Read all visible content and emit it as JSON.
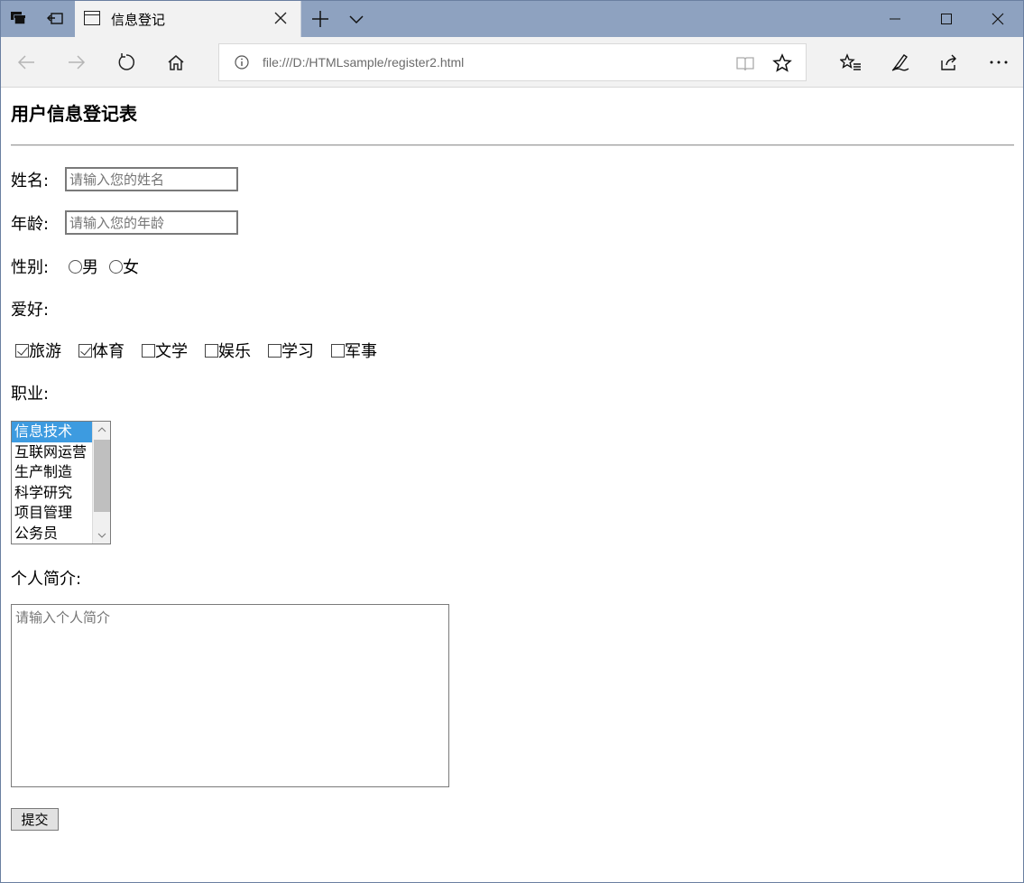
{
  "browser": {
    "tab_title": "信息登记",
    "url": "file:///D:/HTMLsample/register2.html"
  },
  "page": {
    "title": "用户信息登记表",
    "name_label": "姓名:",
    "name_placeholder": "请输入您的姓名",
    "age_label": "年龄:",
    "age_placeholder": "请输入您的年龄",
    "gender_label": "性别:",
    "gender_options": [
      "男",
      "女"
    ],
    "hobby_label": "爱好:",
    "hobbies": [
      {
        "label": "旅游",
        "checked": true
      },
      {
        "label": "体育",
        "checked": true
      },
      {
        "label": "文学",
        "checked": false
      },
      {
        "label": "娱乐",
        "checked": false
      },
      {
        "label": "学习",
        "checked": false
      },
      {
        "label": "军事",
        "checked": false
      }
    ],
    "job_label": "职业:",
    "jobs": [
      "信息技术",
      "互联网运营",
      "生产制造",
      "科学研究",
      "项目管理",
      "公务员"
    ],
    "selected_job": "信息技术",
    "bio_label": "个人简介:",
    "bio_placeholder": "请输入个人简介",
    "submit_label": "提交"
  },
  "colors": {
    "titlebar": "#8ea2c0",
    "selected_option": "#3d9be0"
  }
}
